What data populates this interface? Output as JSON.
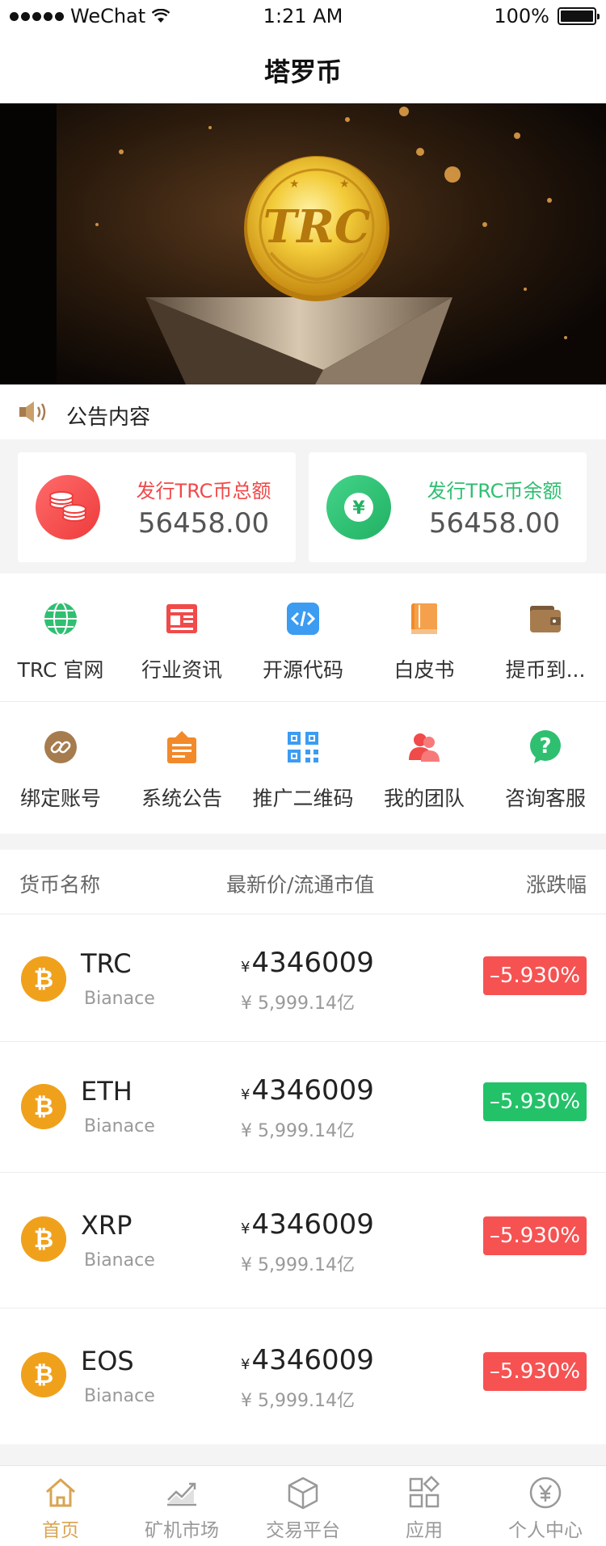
{
  "status_bar": {
    "carrier": "WeChat",
    "time": "1:21 AM",
    "battery": "100%"
  },
  "nav": {
    "title": "塔罗币"
  },
  "notice": {
    "text": "公告内容"
  },
  "stats": [
    {
      "label": "发行TRC币总额",
      "value": "56458.00",
      "color": "#f04a4a"
    },
    {
      "label": "发行TRC币余额",
      "value": "56458.00",
      "color": "#2fbf71"
    }
  ],
  "menu": [
    {
      "label": "TRC 官网",
      "icon": "globe-icon"
    },
    {
      "label": "行业资讯",
      "icon": "news-icon"
    },
    {
      "label": "开源代码",
      "icon": "code-icon"
    },
    {
      "label": "白皮书",
      "icon": "book-icon"
    },
    {
      "label": "提币到...",
      "icon": "wallet-icon"
    },
    {
      "label": "绑定账号",
      "icon": "link-icon"
    },
    {
      "label": "系统公告",
      "icon": "announcement-icon"
    },
    {
      "label": "推广二维码",
      "icon": "qrcode-icon"
    },
    {
      "label": "我的团队",
      "icon": "team-icon"
    },
    {
      "label": "咨询客服",
      "icon": "help-icon"
    }
  ],
  "market": {
    "headers": {
      "name": "货币名称",
      "price": "最新价/流通市值",
      "change": "涨跌幅"
    },
    "rows": [
      {
        "symbol": "TRC",
        "exchange": "Bianace",
        "currency": "¥",
        "price": "4346009",
        "cap": "¥ 5,999.14亿",
        "change": "–5.930%",
        "change_color": "#f65252"
      },
      {
        "symbol": "ETH",
        "exchange": "Bianace",
        "currency": "¥",
        "price": "4346009",
        "cap": "¥ 5,999.14亿",
        "change": "–5.930%",
        "change_color": "#23c269"
      },
      {
        "symbol": "XRP",
        "exchange": "Bianace",
        "currency": "¥",
        "price": "4346009",
        "cap": "¥ 5,999.14亿",
        "change": "–5.930%",
        "change_color": "#f65252"
      },
      {
        "symbol": "EOS",
        "exchange": "Bianace",
        "currency": "¥",
        "price": "4346009",
        "cap": "¥ 5,999.14亿",
        "change": "–5.930%",
        "change_color": "#f65252"
      }
    ]
  },
  "tabs": [
    {
      "label": "首页",
      "icon": "home-icon",
      "active": true
    },
    {
      "label": "矿机市场",
      "icon": "chart-icon",
      "active": false
    },
    {
      "label": "交易平台",
      "icon": "box-icon",
      "active": false
    },
    {
      "label": "应用",
      "icon": "apps-icon",
      "active": false
    },
    {
      "label": "个人中心",
      "icon": "yen-icon",
      "active": false
    }
  ],
  "colors": {
    "accent": "#d9a453",
    "coin": "#f0a11c",
    "up": "#23c269",
    "down": "#f65252"
  }
}
